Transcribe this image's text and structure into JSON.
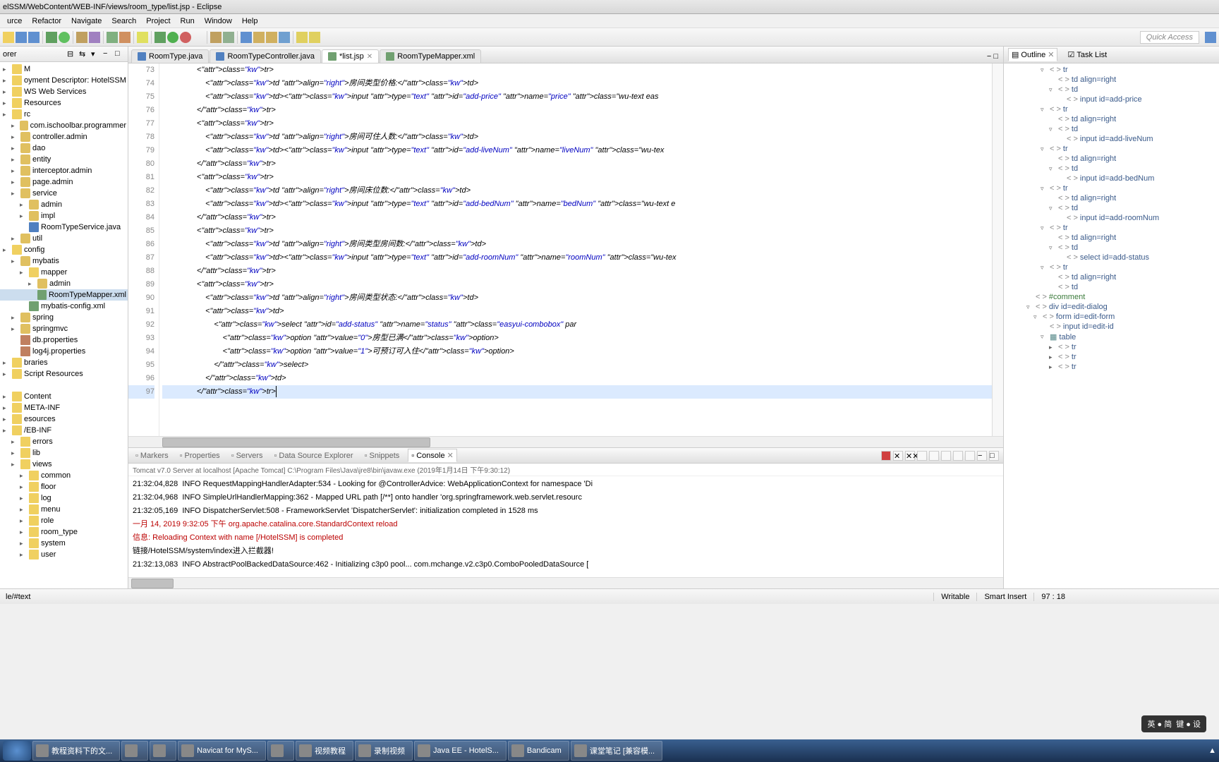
{
  "title": "elSSM/WebContent/WEB-INF/views/room_type/list.jsp - Eclipse",
  "menus": [
    "urce",
    "Refactor",
    "Navigate",
    "Search",
    "Project",
    "Run",
    "Window",
    "Help"
  ],
  "quick_access": "Quick Access",
  "left_header": "orer",
  "explorer_items": [
    {
      "t": "M",
      "ind": 0,
      "k": "fold"
    },
    {
      "t": "oyment Descriptor: HotelSSM",
      "ind": 0,
      "k": "fold"
    },
    {
      "t": "WS Web Services",
      "ind": 0,
      "k": "fold"
    },
    {
      "t": "Resources",
      "ind": 0,
      "k": "fold"
    },
    {
      "t": "rc",
      "ind": 0,
      "k": "fold"
    },
    {
      "t": "com.ischoolbar.programmer",
      "ind": 1,
      "k": "pkg"
    },
    {
      "t": "controller.admin",
      "ind": 1,
      "k": "pkg"
    },
    {
      "t": "dao",
      "ind": 1,
      "k": "pkg"
    },
    {
      "t": "entity",
      "ind": 1,
      "k": "pkg"
    },
    {
      "t": "interceptor.admin",
      "ind": 1,
      "k": "pkg"
    },
    {
      "t": "page.admin",
      "ind": 1,
      "k": "pkg"
    },
    {
      "t": "service",
      "ind": 1,
      "k": "pkg"
    },
    {
      "t": "admin",
      "ind": 2,
      "k": "pkg"
    },
    {
      "t": "impl",
      "ind": 2,
      "k": "pkg"
    },
    {
      "t": "RoomTypeService.java",
      "ind": 2,
      "k": "java"
    },
    {
      "t": "util",
      "ind": 1,
      "k": "pkg"
    },
    {
      "t": "config",
      "ind": 0,
      "k": "fold"
    },
    {
      "t": "mybatis",
      "ind": 1,
      "k": "pkg"
    },
    {
      "t": "mapper",
      "ind": 2,
      "k": "fold"
    },
    {
      "t": "admin",
      "ind": 3,
      "k": "pkg"
    },
    {
      "t": "RoomTypeMapper.xml",
      "ind": 3,
      "k": "xml",
      "sel": true
    },
    {
      "t": "mybatis-config.xml",
      "ind": 2,
      "k": "xml"
    },
    {
      "t": "spring",
      "ind": 1,
      "k": "pkg"
    },
    {
      "t": "springmvc",
      "ind": 1,
      "k": "pkg"
    },
    {
      "t": "db.properties",
      "ind": 1,
      "k": "prop"
    },
    {
      "t": "log4j.properties",
      "ind": 1,
      "k": "prop"
    },
    {
      "t": "braries",
      "ind": 0,
      "k": "fold"
    },
    {
      "t": "Script Resources",
      "ind": 0,
      "k": "fold"
    },
    {
      "t": "",
      "ind": 0,
      "k": ""
    },
    {
      "t": "Content",
      "ind": 0,
      "k": "fold"
    },
    {
      "t": "META-INF",
      "ind": 0,
      "k": "fold"
    },
    {
      "t": "esources",
      "ind": 0,
      "k": "fold"
    },
    {
      "t": "/EB-INF",
      "ind": 0,
      "k": "fold"
    },
    {
      "t": "errors",
      "ind": 1,
      "k": "fold"
    },
    {
      "t": "lib",
      "ind": 1,
      "k": "fold"
    },
    {
      "t": "views",
      "ind": 1,
      "k": "fold"
    },
    {
      "t": "common",
      "ind": 2,
      "k": "fold"
    },
    {
      "t": "floor",
      "ind": 2,
      "k": "fold"
    },
    {
      "t": "log",
      "ind": 2,
      "k": "fold"
    },
    {
      "t": "menu",
      "ind": 2,
      "k": "fold"
    },
    {
      "t": "role",
      "ind": 2,
      "k": "fold"
    },
    {
      "t": "room_type",
      "ind": 2,
      "k": "fold"
    },
    {
      "t": "system",
      "ind": 2,
      "k": "fold"
    },
    {
      "t": "user",
      "ind": 2,
      "k": "fold"
    }
  ],
  "editor_tabs": [
    {
      "label": "RoomType.java",
      "icon": "java"
    },
    {
      "label": "RoomTypeController.java",
      "icon": "java"
    },
    {
      "label": "*list.jsp",
      "icon": "xml",
      "active": true,
      "close": true
    },
    {
      "label": "RoomTypeMapper.xml",
      "icon": "xml"
    }
  ],
  "line_start": 73,
  "line_end": 97,
  "cursor_line": 97,
  "code_lines": [
    "                <tr>",
    "                    <td align=\"right\">房间类型价格:</td>",
    "                    <td><input type=\"text\" id=\"add-price\" name=\"price\" class=\"wu-text eas",
    "                </tr>",
    "                <tr>",
    "                    <td align=\"right\">房间可住人数:</td>",
    "                    <td><input type=\"text\" id=\"add-liveNum\" name=\"liveNum\" class=\"wu-tex",
    "                </tr>",
    "                <tr>",
    "                    <td align=\"right\">房间床位数:</td>",
    "                    <td><input type=\"text\" id=\"add-bedNum\" name=\"bedNum\" class=\"wu-text e",
    "                </tr>",
    "                <tr>",
    "                    <td align=\"right\">房间类型房间数:</td>",
    "                    <td><input type=\"text\" id=\"add-roomNum\" name=\"roomNum\" class=\"wu-tex",
    "                </tr>",
    "                <tr>",
    "                    <td align=\"right\">房间类型状态:</td>",
    "                    <td>",
    "                        <select id=\"add-status\" name=\"status\" class=\"easyui-combobox\" par",
    "                            <option value=\"0\">房型已满</option>",
    "                            <option value=\"1\">可预订可入住</option>",
    "                        </select>",
    "                    </td>",
    "                </tr>"
  ],
  "right_tabs": {
    "outline": "Outline",
    "tasklist": "Task List"
  },
  "outline_items": [
    {
      "ind": 1,
      "a": "▿",
      "t": "tr"
    },
    {
      "ind": 2,
      "a": "",
      "t": "td align=right"
    },
    {
      "ind": 2,
      "a": "▿",
      "t": "td"
    },
    {
      "ind": 3,
      "a": "",
      "t": "input id=add-price"
    },
    {
      "ind": 1,
      "a": "▿",
      "t": "tr"
    },
    {
      "ind": 2,
      "a": "",
      "t": "td align=right"
    },
    {
      "ind": 2,
      "a": "▿",
      "t": "td"
    },
    {
      "ind": 3,
      "a": "",
      "t": "input id=add-liveNum"
    },
    {
      "ind": 1,
      "a": "▿",
      "t": "tr"
    },
    {
      "ind": 2,
      "a": "",
      "t": "td align=right"
    },
    {
      "ind": 2,
      "a": "▿",
      "t": "td"
    },
    {
      "ind": 3,
      "a": "",
      "t": "input id=add-bedNum"
    },
    {
      "ind": 1,
      "a": "▿",
      "t": "tr"
    },
    {
      "ind": 2,
      "a": "",
      "t": "td align=right"
    },
    {
      "ind": 2,
      "a": "▿",
      "t": "td"
    },
    {
      "ind": 3,
      "a": "",
      "t": "input id=add-roomNum"
    },
    {
      "ind": 1,
      "a": "▿",
      "t": "tr"
    },
    {
      "ind": 2,
      "a": "",
      "t": "td align=right"
    },
    {
      "ind": 2,
      "a": "▿",
      "t": "td"
    },
    {
      "ind": 3,
      "a": "",
      "t": "select id=add-status"
    },
    {
      "ind": 1,
      "a": "▿",
      "t": "tr"
    },
    {
      "ind": 2,
      "a": "",
      "t": "td align=right"
    },
    {
      "ind": 2,
      "a": "",
      "t": "td"
    },
    {
      "ind": 0,
      "a": "",
      "t": "#comment",
      "cm": true
    },
    {
      "ind": 0,
      "a": "▿",
      "t": "div id=edit-dialog"
    },
    {
      "ind": "0b",
      "a": "▿",
      "t": "form id=edit-form"
    },
    {
      "ind": 1,
      "a": "",
      "t": "input id=edit-id"
    },
    {
      "ind": 1,
      "a": "▿",
      "t": "table",
      "tbl": true
    },
    {
      "ind": 2,
      "a": "▸",
      "t": "tr"
    },
    {
      "ind": 2,
      "a": "▸",
      "t": "tr"
    },
    {
      "ind": 2,
      "a": "▸",
      "t": "tr"
    }
  ],
  "bottom_tabs": [
    "Markers",
    "Properties",
    "Servers",
    "Data Source Explorer",
    "Snippets",
    "Console"
  ],
  "bottom_active": "Console",
  "console_desc": "Tomcat v7.0 Server at localhost [Apache Tomcat] C:\\Program Files\\Java\\jre8\\bin\\javaw.exe (2019年1月14日 下午9:30:12)",
  "console_lines": [
    {
      "t": "21:32:04,828  INFO RequestMappingHandlerAdapter:534 - Looking for @ControllerAdvice: WebApplicationContext for namespace 'Di"
    },
    {
      "t": "21:32:04,968  INFO SimpleUrlHandlerMapping:362 - Mapped URL path [/**] onto handler 'org.springframework.web.servlet.resourc"
    },
    {
      "t": "21:32:05,169  INFO DispatcherServlet:508 - FrameworkServlet 'DispatcherServlet': initialization completed in 1528 ms"
    },
    {
      "t": "一月 14, 2019 9:32:05 下午 org.apache.catalina.core.StandardContext reload",
      "red": true
    },
    {
      "t": "信息: Reloading Context with name [/HotelSSM] is completed",
      "red": true
    },
    {
      "t": "链接/HotelSSM/system/index进入拦截器!"
    },
    {
      "t": "21:32:13,083  INFO AbstractPoolBackedDataSource:462 - Initializing c3p0 pool... com.mchange.v2.c3p0.ComboPooledDataSource [ "
    }
  ],
  "status": {
    "path": "le/#text",
    "writable": "Writable",
    "insert": "Smart Insert",
    "pos": "97 : 18"
  },
  "taskbar_items": [
    {
      "t": "教程资料下的文..."
    },
    {
      "t": ""
    },
    {
      "t": ""
    },
    {
      "t": "Navicat for MyS..."
    },
    {
      "t": ""
    },
    {
      "t": "视频教程"
    },
    {
      "t": "录制视频"
    },
    {
      "t": "Java EE - HotelS..."
    },
    {
      "t": "Bandicam"
    },
    {
      "t": "课堂笔记 [兼容模..."
    }
  ],
  "ime": {
    "l1": "英 ● 简",
    "l2": "键 ● 设"
  }
}
